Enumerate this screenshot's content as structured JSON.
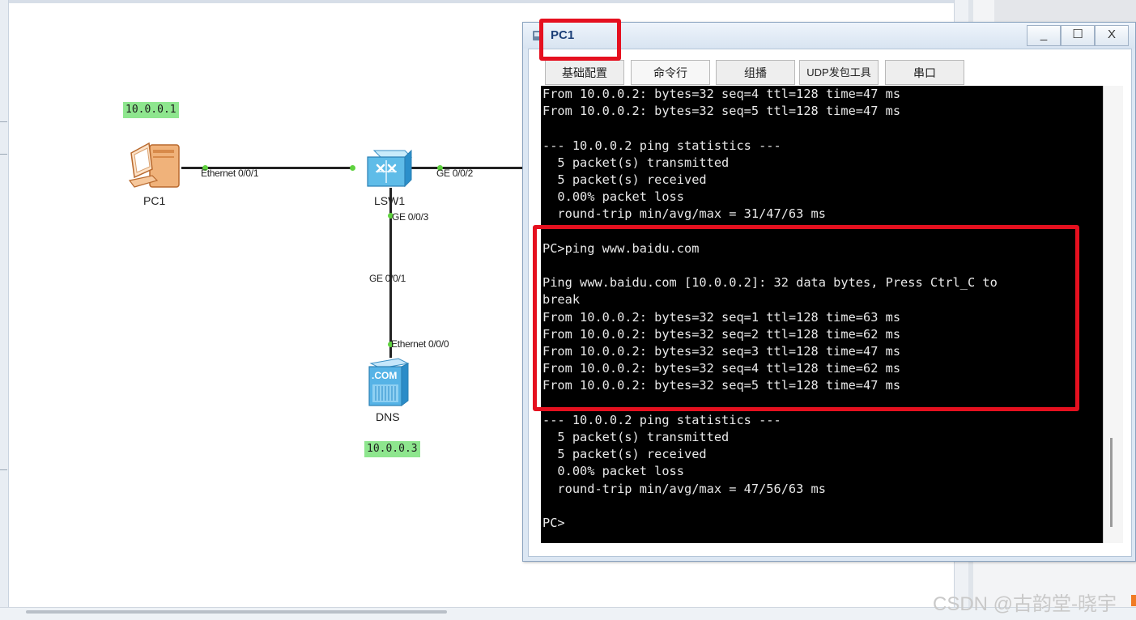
{
  "topology": {
    "pc1": {
      "name": "PC1",
      "ip": "10.0.0.1",
      "port": "Ethernet 0/0/1"
    },
    "lsw1": {
      "name": "LSW1",
      "port_left": "GE 0/0/2",
      "port_down": "GE 0/0/3"
    },
    "dns": {
      "name": "DNS",
      "ip": "10.0.0.3",
      "port_up": "GE 0/0/1",
      "port": "Ethernet 0/0/0",
      "icon_text": ".COM"
    }
  },
  "window": {
    "title": "PC1",
    "buttons": {
      "minimize": "_",
      "maximize": "☐",
      "close": "X"
    },
    "tabs": [
      "基础配置",
      "命令行",
      "组播",
      "UDP发包工具",
      "串口"
    ],
    "terminal_lines": [
      "From 10.0.0.2: bytes=32 seq=4 ttl=128 time=47 ms",
      "From 10.0.0.2: bytes=32 seq=5 ttl=128 time=47 ms",
      "",
      "--- 10.0.0.2 ping statistics ---",
      "  5 packet(s) transmitted",
      "  5 packet(s) received",
      "  0.00% packet loss",
      "  round-trip min/avg/max = 31/47/63 ms",
      "",
      "PC>ping www.baidu.com",
      "",
      "Ping www.baidu.com [10.0.0.2]: 32 data bytes, Press Ctrl_C to",
      "break",
      "From 10.0.0.2: bytes=32 seq=1 ttl=128 time=63 ms",
      "From 10.0.0.2: bytes=32 seq=2 ttl=128 time=62 ms",
      "From 10.0.0.2: bytes=32 seq=3 ttl=128 time=47 ms",
      "From 10.0.0.2: bytes=32 seq=4 ttl=128 time=62 ms",
      "From 10.0.0.2: bytes=32 seq=5 ttl=128 time=47 ms",
      "",
      "--- 10.0.0.2 ping statistics ---",
      "  5 packet(s) transmitted",
      "  5 packet(s) received",
      "  0.00% packet loss",
      "  round-trip min/avg/max = 47/56/63 ms",
      "",
      "PC>"
    ]
  },
  "watermark": "CSDN @古韵堂-晓宇",
  "colors": {
    "highlight": "#e5101f",
    "ip_label_bg": "#8ee68e",
    "link_dot": "#5fd23f",
    "terminal_bg": "#000000"
  }
}
